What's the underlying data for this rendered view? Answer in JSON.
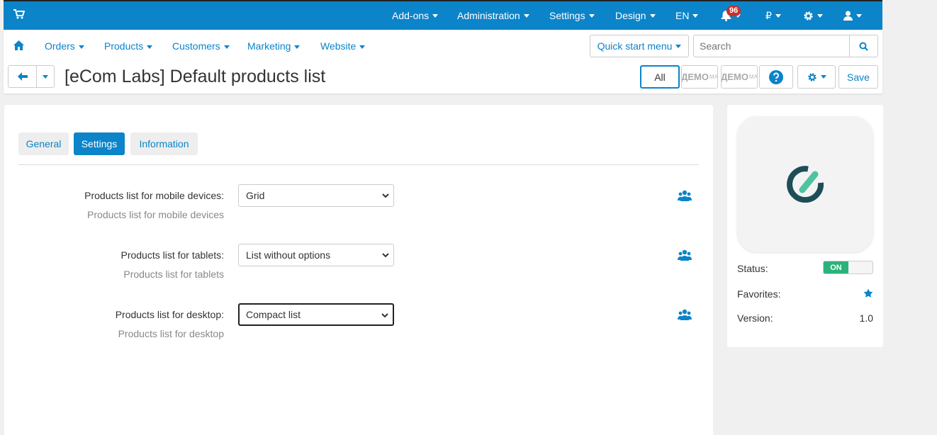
{
  "topbar": {
    "menus": [
      "Add-ons",
      "Administration",
      "Settings",
      "Design",
      "EN"
    ],
    "notifications_count": "96",
    "currency": "₽"
  },
  "navbar": {
    "items": [
      "Orders",
      "Products",
      "Customers",
      "Marketing",
      "Website"
    ],
    "quick_start_label": "Quick start menu",
    "search_placeholder": "Search"
  },
  "page": {
    "title": "[eCom Labs] Default products list",
    "all_label": "All",
    "demo_label": "ДЕМО",
    "demo_small": "МА",
    "save_label": "Save"
  },
  "tabs": [
    {
      "label": "General",
      "active": false
    },
    {
      "label": "Settings",
      "active": true
    },
    {
      "label": "Information",
      "active": false
    }
  ],
  "settings": [
    {
      "label": "Products list for mobile devices:",
      "description": "Products list for mobile devices",
      "value": "Grid"
    },
    {
      "label": "Products list for tablets:",
      "description": "Products list for tablets",
      "value": "List without options"
    },
    {
      "label": "Products list for desktop:",
      "description": "Products list for desktop",
      "value": "Compact list"
    }
  ],
  "sidebar": {
    "status_label": "Status:",
    "status_value": "ON",
    "favorites_label": "Favorites:",
    "version_label": "Version:",
    "version_value": "1.0"
  },
  "colors": {
    "primary": "#0b84c9",
    "toggle_on": "#2ab27b",
    "badge": "#c9302c",
    "logo_dark": "#1d4e57",
    "logo_accent": "#4fc3a1"
  }
}
